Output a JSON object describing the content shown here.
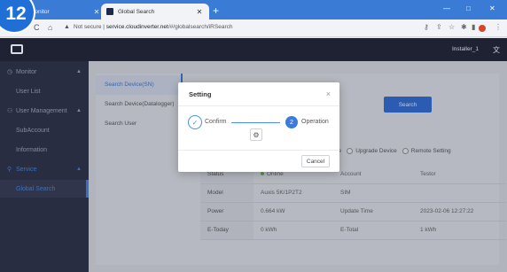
{
  "step_badge": "12",
  "browser": {
    "tabs": [
      {
        "title": "Monitor",
        "active": false
      },
      {
        "title": "Global Search",
        "active": true
      }
    ],
    "new_tab": "+",
    "window_controls": [
      "—",
      "□",
      "✕"
    ],
    "security_label": "Not secure",
    "url_host": "service.cloudinverter.net",
    "url_path": "/#/globalsearch/iRSearch"
  },
  "header": {
    "user": "Installer_1",
    "lang_icon": "translate-icon"
  },
  "sidebar": {
    "items": [
      {
        "label": "Monitor",
        "type": "group",
        "icon": "monitor-icon",
        "chevron": "^"
      },
      {
        "label": "User List",
        "type": "sub"
      },
      {
        "label": "User Management",
        "type": "group",
        "icon": "user-icon",
        "chevron": "^"
      },
      {
        "label": "SubAccount",
        "type": "sub"
      },
      {
        "label": "Information",
        "type": "sub"
      },
      {
        "label": "Service",
        "type": "group",
        "icon": "search-icon",
        "chevron": "^"
      },
      {
        "label": "Global Search",
        "type": "sub",
        "active": true
      }
    ]
  },
  "subnav": [
    {
      "label": "Search Device(SN)",
      "active": true
    },
    {
      "label": "Search Device(Datalogger)",
      "active": false
    },
    {
      "label": "Search User",
      "active": false
    }
  ],
  "search_button": "Search",
  "radios": [
    {
      "label": "evice"
    },
    {
      "label": "Upgrade Device"
    },
    {
      "label": "Remote Setting"
    }
  ],
  "info_table": [
    [
      "Status",
      "Online",
      "Account",
      "Testor"
    ],
    [
      "Model",
      "Auxis 5K/1P2T2",
      "SIM",
      ""
    ],
    [
      "Power",
      "0.664 kW",
      "Update Time",
      "2023-02-06 12:27:22"
    ],
    [
      "E-Today",
      "0 kWh",
      "E-Total",
      "1 kWh"
    ]
  ],
  "dialog": {
    "title": "Setting",
    "close": "×",
    "step1": {
      "label": "Confirm",
      "mark": "✓"
    },
    "step2": {
      "number": "2",
      "label": "Operation"
    },
    "gear": "⚙",
    "cancel": "Cancel"
  },
  "colors": {
    "accent": "#3d7bd9",
    "sidebar": "#2a2f43",
    "header": "#1e2233",
    "online": "#6abf4b"
  }
}
